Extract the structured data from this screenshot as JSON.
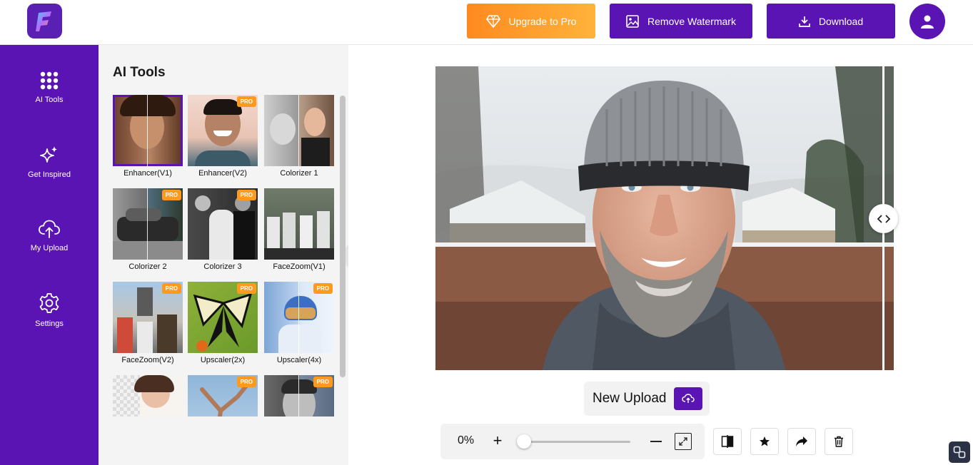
{
  "header": {
    "upgrade_label": "Upgrade to Pro",
    "remove_watermark_label": "Remove Watermark",
    "download_label": "Download"
  },
  "rail": {
    "items": [
      {
        "label": "AI Tools",
        "icon": "grid-icon"
      },
      {
        "label": "Get Inspired",
        "icon": "sparkles-icon"
      },
      {
        "label": "My Upload",
        "icon": "cloud-upload-icon"
      },
      {
        "label": "Settings",
        "icon": "gear-icon"
      }
    ]
  },
  "panel": {
    "title": "AI Tools",
    "pro_badge": "PRO",
    "tools": [
      {
        "name": "Enhancer(V1)",
        "pro": false,
        "selected": true
      },
      {
        "name": "Enhancer(V2)",
        "pro": true,
        "selected": false
      },
      {
        "name": "Colorizer 1",
        "pro": false,
        "selected": false
      },
      {
        "name": "Colorizer 2",
        "pro": true,
        "selected": false
      },
      {
        "name": "Colorizer 3",
        "pro": true,
        "selected": false
      },
      {
        "name": "FaceZoom(V1)",
        "pro": false,
        "selected": false
      },
      {
        "name": "FaceZoom(V2)",
        "pro": true,
        "selected": false
      },
      {
        "name": "Upscaler(2x)",
        "pro": true,
        "selected": false
      },
      {
        "name": "Upscaler(4x)",
        "pro": true,
        "selected": false
      },
      {
        "name": "",
        "pro": false,
        "selected": false
      },
      {
        "name": "",
        "pro": true,
        "selected": false
      },
      {
        "name": "",
        "pro": true,
        "selected": false
      }
    ]
  },
  "editor": {
    "new_upload_label": "New Upload",
    "zoom_percent": "0%",
    "zoom_plus": "+"
  },
  "colors": {
    "brand_purple": "#5a14b4",
    "upgrade_orange": "#ff8a1f",
    "pro_badge": "#ff9a1e"
  }
}
